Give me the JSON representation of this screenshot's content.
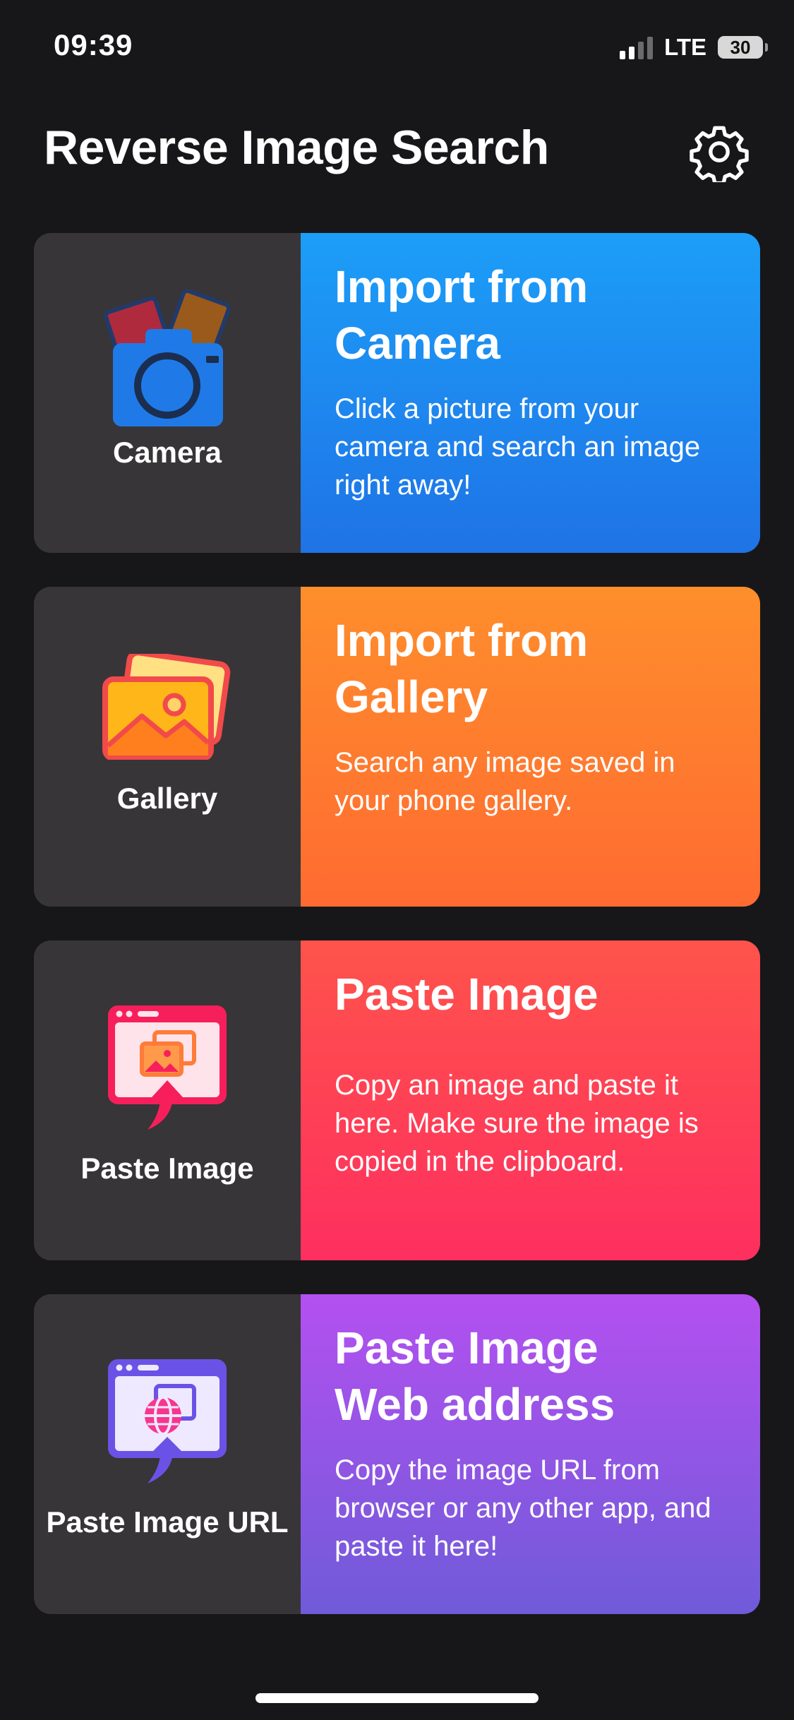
{
  "status_bar": {
    "time": "09:39",
    "network": "LTE",
    "battery": "30"
  },
  "header": {
    "title": "Reverse Image Search",
    "settings_icon": "gear-icon"
  },
  "cards": [
    {
      "id": "camera",
      "icon": "camera-icon",
      "caption": "Camera",
      "title_line1": "Import from",
      "title_line2": "Camera",
      "description": "Click a picture from your camera and search an image right away!",
      "accent": "#1e8cf0"
    },
    {
      "id": "gallery",
      "icon": "gallery-icon",
      "caption": "Gallery",
      "title_line1": "Import from",
      "title_line2": "Gallery",
      "description": "Search any image saved in your phone gallery.",
      "accent": "#ff7d2e"
    },
    {
      "id": "paste-image",
      "icon": "paste-image-icon",
      "caption": "Paste Image",
      "title_line1": "Paste Image",
      "title_line2": "",
      "description": "Copy an image and paste it here. Make sure the image is copied in the clipboard.",
      "accent": "#fe4255"
    },
    {
      "id": "paste-url",
      "icon": "paste-url-icon",
      "caption": "Paste Image URL",
      "title_line1": "Paste Image",
      "title_line2": "Web address",
      "description": "Copy the image URL from browser or any other app, and paste it here!",
      "accent": "#9156e4"
    }
  ]
}
